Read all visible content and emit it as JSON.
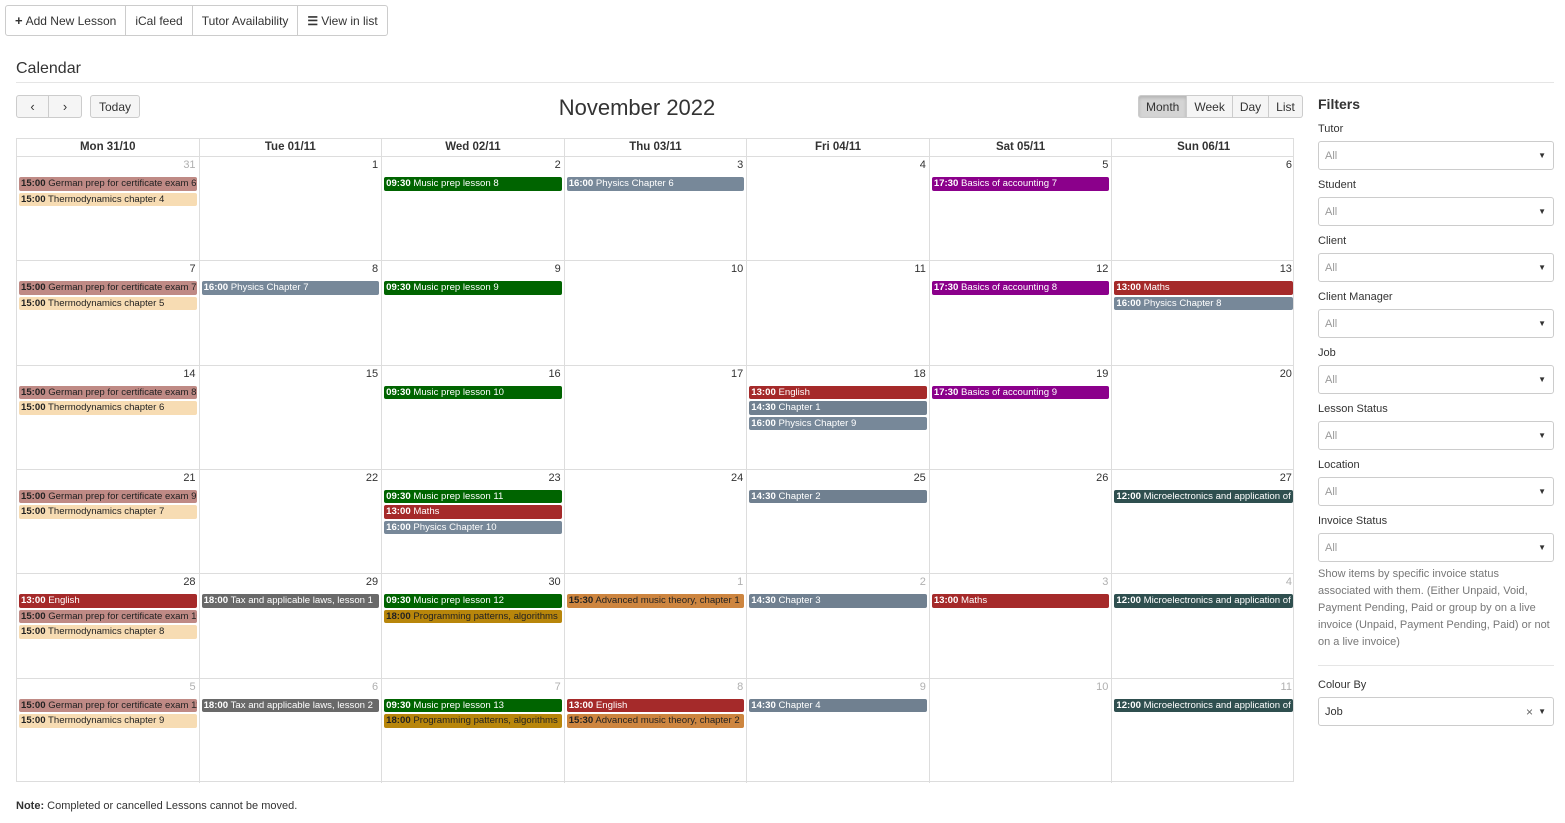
{
  "toolbar": {
    "add_lesson": "Add New Lesson",
    "ical": "iCal feed",
    "tutor_availability": "Tutor Availability",
    "view_list": "View in list"
  },
  "page_title": "Calendar",
  "nav": {
    "prev": "‹",
    "next": "›",
    "today": "Today"
  },
  "month_title": "November 2022",
  "views": [
    "Month",
    "Week",
    "Day",
    "List"
  ],
  "active_view": "Month",
  "weekdays": [
    "Mon 31/10",
    "Tue 01/11",
    "Wed 02/11",
    "Thu 03/11",
    "Fri 04/11",
    "Sat 05/11",
    "Sun 06/11"
  ],
  "colors": {
    "german": "#bf8a85",
    "thermo": "#f7dcb3",
    "music": "#006400",
    "physics": "#778899",
    "accounting": "#8b008b",
    "maths": "#a52a2a",
    "english": "#a52a2a",
    "chapter": "#708090",
    "micro": "#2f4f4f",
    "tax": "#696969",
    "programming": "#b8860b",
    "advmusic": "#cd853f"
  },
  "weeks": [
    {
      "days": [
        {
          "num": "31",
          "other": true,
          "events": [
            {
              "time": "15:00",
              "title": "German prep for certificate exam 6",
              "color": "german",
              "dark": true
            },
            {
              "time": "15:00",
              "title": "Thermodynamics chapter 4",
              "color": "thermo",
              "dark": true
            }
          ]
        },
        {
          "num": "1",
          "other": false,
          "events": []
        },
        {
          "num": "2",
          "other": false,
          "events": [
            {
              "time": "09:30",
              "title": "Music prep lesson 8",
              "color": "music"
            }
          ]
        },
        {
          "num": "3",
          "other": false,
          "events": [
            {
              "time": "16:00",
              "title": "Physics Chapter 6",
              "color": "physics"
            }
          ]
        },
        {
          "num": "4",
          "other": false,
          "events": []
        },
        {
          "num": "5",
          "other": false,
          "events": [
            {
              "time": "17:30",
              "title": "Basics of accounting 7",
              "color": "accounting"
            }
          ]
        },
        {
          "num": "6",
          "other": false,
          "events": []
        }
      ]
    },
    {
      "days": [
        {
          "num": "7",
          "other": false,
          "events": [
            {
              "time": "15:00",
              "title": "German prep for certificate exam 7",
              "color": "german",
              "dark": true
            },
            {
              "time": "15:00",
              "title": "Thermodynamics chapter 5",
              "color": "thermo",
              "dark": true
            }
          ]
        },
        {
          "num": "8",
          "other": false,
          "events": [
            {
              "time": "16:00",
              "title": "Physics Chapter 7",
              "color": "physics"
            }
          ]
        },
        {
          "num": "9",
          "other": false,
          "events": [
            {
              "time": "09:30",
              "title": "Music prep lesson 9",
              "color": "music"
            }
          ]
        },
        {
          "num": "10",
          "other": false,
          "events": []
        },
        {
          "num": "11",
          "other": false,
          "events": []
        },
        {
          "num": "12",
          "other": false,
          "events": [
            {
              "time": "17:30",
              "title": "Basics of accounting 8",
              "color": "accounting"
            }
          ]
        },
        {
          "num": "13",
          "other": false,
          "events": [
            {
              "time": "13:00",
              "title": "Maths",
              "color": "maths"
            },
            {
              "time": "16:00",
              "title": "Physics Chapter 8",
              "color": "physics"
            }
          ]
        }
      ]
    },
    {
      "days": [
        {
          "num": "14",
          "other": false,
          "events": [
            {
              "time": "15:00",
              "title": "German prep for certificate exam 8",
              "color": "german",
              "dark": true
            },
            {
              "time": "15:00",
              "title": "Thermodynamics chapter 6",
              "color": "thermo",
              "dark": true
            }
          ]
        },
        {
          "num": "15",
          "other": false,
          "events": []
        },
        {
          "num": "16",
          "other": false,
          "events": [
            {
              "time": "09:30",
              "title": "Music prep lesson 10",
              "color": "music"
            }
          ]
        },
        {
          "num": "17",
          "other": false,
          "events": []
        },
        {
          "num": "18",
          "other": false,
          "events": [
            {
              "time": "13:00",
              "title": "English",
              "color": "english"
            },
            {
              "time": "14:30",
              "title": "Chapter 1",
              "color": "chapter"
            },
            {
              "time": "16:00",
              "title": "Physics Chapter 9",
              "color": "physics"
            }
          ]
        },
        {
          "num": "19",
          "other": false,
          "events": [
            {
              "time": "17:30",
              "title": "Basics of accounting 9",
              "color": "accounting"
            }
          ]
        },
        {
          "num": "20",
          "other": false,
          "events": []
        }
      ]
    },
    {
      "days": [
        {
          "num": "21",
          "other": false,
          "events": [
            {
              "time": "15:00",
              "title": "German prep for certificate exam 9",
              "color": "german",
              "dark": true
            },
            {
              "time": "15:00",
              "title": "Thermodynamics chapter 7",
              "color": "thermo",
              "dark": true
            }
          ]
        },
        {
          "num": "22",
          "other": false,
          "events": []
        },
        {
          "num": "23",
          "other": false,
          "events": [
            {
              "time": "09:30",
              "title": "Music prep lesson 11",
              "color": "music"
            },
            {
              "time": "13:00",
              "title": "Maths",
              "color": "maths"
            },
            {
              "time": "16:00",
              "title": "Physics Chapter 10",
              "color": "physics"
            }
          ]
        },
        {
          "num": "24",
          "other": false,
          "events": []
        },
        {
          "num": "25",
          "other": false,
          "events": [
            {
              "time": "14:30",
              "title": "Chapter 2",
              "color": "chapter"
            }
          ]
        },
        {
          "num": "26",
          "other": false,
          "events": []
        },
        {
          "num": "27",
          "other": false,
          "events": [
            {
              "time": "12:00",
              "title": "Microelectronics and application of",
              "color": "micro"
            }
          ]
        }
      ]
    },
    {
      "days": [
        {
          "num": "28",
          "other": false,
          "events": [
            {
              "time": "13:00",
              "title": "English",
              "color": "english"
            },
            {
              "time": "15:00",
              "title": "German prep for certificate exam 10",
              "color": "german",
              "dark": true
            },
            {
              "time": "15:00",
              "title": "Thermodynamics chapter 8",
              "color": "thermo",
              "dark": true
            }
          ]
        },
        {
          "num": "29",
          "other": false,
          "events": [
            {
              "time": "18:00",
              "title": "Tax and applicable laws, lesson 1",
              "color": "tax"
            }
          ]
        },
        {
          "num": "30",
          "other": false,
          "events": [
            {
              "time": "09:30",
              "title": "Music prep lesson 12",
              "color": "music"
            },
            {
              "time": "18:00",
              "title": "Programming patterns, algorithms",
              "color": "programming",
              "dark": true
            }
          ]
        },
        {
          "num": "1",
          "other": true,
          "events": [
            {
              "time": "15:30",
              "title": "Advanced music theory, chapter 1",
              "color": "advmusic",
              "dark": true
            }
          ]
        },
        {
          "num": "2",
          "other": true,
          "events": [
            {
              "time": "14:30",
              "title": "Chapter 3",
              "color": "chapter"
            }
          ]
        },
        {
          "num": "3",
          "other": true,
          "events": [
            {
              "time": "13:00",
              "title": "Maths",
              "color": "maths"
            }
          ]
        },
        {
          "num": "4",
          "other": true,
          "events": [
            {
              "time": "12:00",
              "title": "Microelectronics and application of",
              "color": "micro"
            }
          ]
        }
      ]
    },
    {
      "days": [
        {
          "num": "5",
          "other": true,
          "events": [
            {
              "time": "15:00",
              "title": "German prep for certificate exam 11",
              "color": "german",
              "dark": true
            },
            {
              "time": "15:00",
              "title": "Thermodynamics chapter 9",
              "color": "thermo",
              "dark": true
            }
          ]
        },
        {
          "num": "6",
          "other": true,
          "events": [
            {
              "time": "18:00",
              "title": "Tax and applicable laws, lesson 2",
              "color": "tax"
            }
          ]
        },
        {
          "num": "7",
          "other": true,
          "events": [
            {
              "time": "09:30",
              "title": "Music prep lesson 13",
              "color": "music"
            },
            {
              "time": "18:00",
              "title": "Programming patterns, algorithms",
              "color": "programming",
              "dark": true
            }
          ]
        },
        {
          "num": "8",
          "other": true,
          "events": [
            {
              "time": "13:00",
              "title": "English",
              "color": "english"
            },
            {
              "time": "15:30",
              "title": "Advanced music theory, chapter 2",
              "color": "advmusic",
              "dark": true
            }
          ]
        },
        {
          "num": "9",
          "other": true,
          "events": [
            {
              "time": "14:30",
              "title": "Chapter 4",
              "color": "chapter"
            }
          ]
        },
        {
          "num": "10",
          "other": true,
          "events": []
        },
        {
          "num": "11",
          "other": true,
          "events": [
            {
              "time": "12:00",
              "title": "Microelectronics and application of",
              "color": "micro"
            }
          ]
        }
      ]
    }
  ],
  "filters": {
    "heading": "Filters",
    "items": [
      {
        "label": "Tutor",
        "value": "All"
      },
      {
        "label": "Student",
        "value": "All"
      },
      {
        "label": "Client",
        "value": "All"
      },
      {
        "label": "Client Manager",
        "value": "All"
      },
      {
        "label": "Job",
        "value": "All"
      },
      {
        "label": "Lesson Status",
        "value": "All"
      },
      {
        "label": "Location",
        "value": "All"
      },
      {
        "label": "Invoice Status",
        "value": "All"
      }
    ],
    "invoice_help": "Show items by specific invoice status associated with them. (Either Unpaid, Void, Payment Pending, Paid or group by on a live invoice (Unpaid, Payment Pending, Paid) or not on a live invoice)",
    "colour_by_label": "Colour By",
    "colour_by_value": "Job",
    "clear_symbol": "×"
  },
  "note": {
    "prefix": "Note:",
    "text": " Completed or cancelled Lessons cannot be moved."
  }
}
